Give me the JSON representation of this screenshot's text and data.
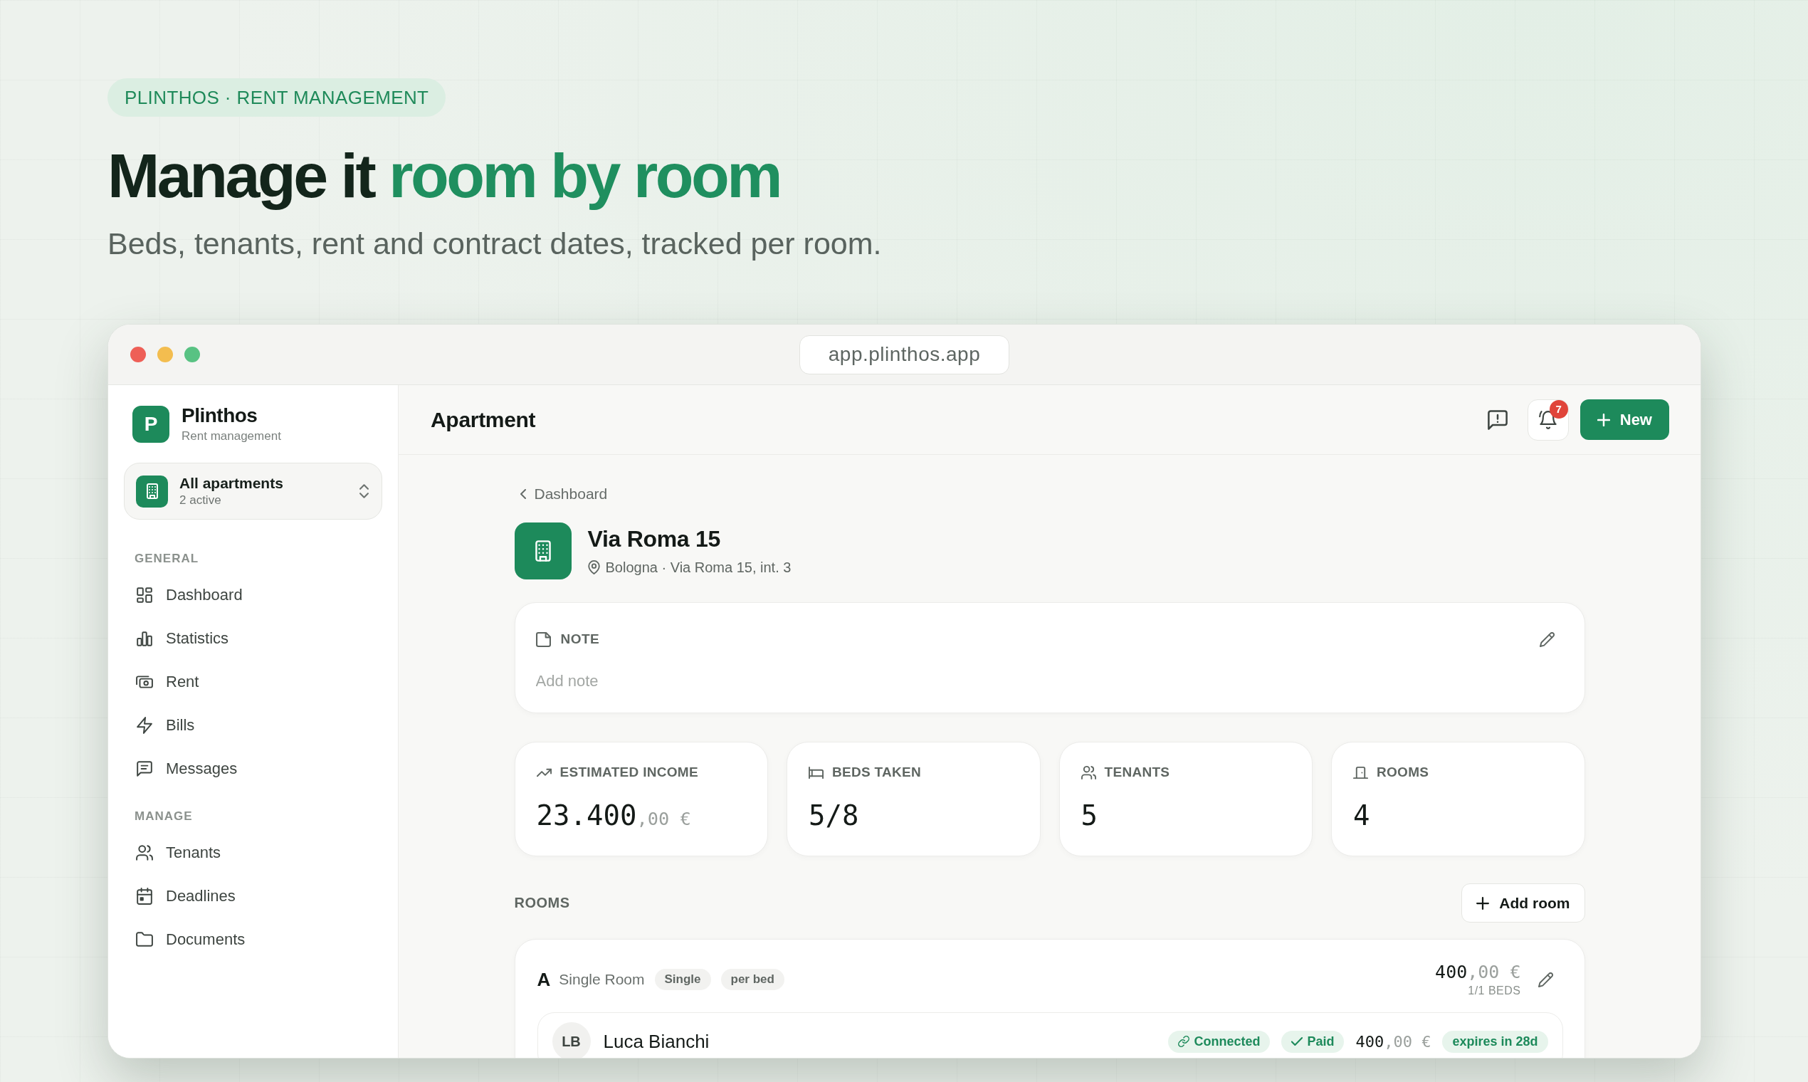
{
  "hero": {
    "eyebrow": "PLINTHOS · RENT MANAGEMENT",
    "title": "Manage it",
    "title_accent": "room by room",
    "subtitle": "Beds, tenants, rent and contract dates, tracked per room."
  },
  "window": {
    "url": "app.plinthos.app"
  },
  "sidebar": {
    "brand": {
      "logo": "P",
      "name": "Plinthos",
      "tagline": "Rent management"
    },
    "switcher": {
      "title": "All apartments",
      "subtitle": "2 active"
    },
    "sections": [
      {
        "heading": "GENERAL",
        "items": [
          {
            "label": "Dashboard",
            "selected": false
          },
          {
            "label": "Statistics",
            "selected": false
          },
          {
            "label": "Rent",
            "selected": false
          },
          {
            "label": "Bills",
            "selected": false
          },
          {
            "label": "Messages",
            "selected": false
          }
        ]
      },
      {
        "heading": "MANAGE",
        "items": [
          {
            "label": "Tenants",
            "selected": false
          },
          {
            "label": "Deadlines",
            "selected": false
          },
          {
            "label": "Documents",
            "selected": false
          }
        ]
      }
    ]
  },
  "header": {
    "title": "Apartment",
    "notification_count": "7",
    "new_button": "New"
  },
  "breadcrumb": {
    "label": "Dashboard"
  },
  "property": {
    "name": "Via Roma 15",
    "location": "Bologna · Via Roma 15, int. 3"
  },
  "note": {
    "label": "NOTE",
    "placeholder": "Add note"
  },
  "stats": [
    {
      "label": "ESTIMATED INCOME",
      "value": "23.400",
      "value_minor": ",00 €"
    },
    {
      "label": "BEDS TAKEN",
      "value": "5/8"
    },
    {
      "label": "TENANTS",
      "value": "5"
    },
    {
      "label": "ROOMS",
      "value": "4"
    }
  ],
  "rooms": {
    "heading": "ROOMS",
    "add_button": "Add room",
    "items": [
      {
        "letter": "A",
        "name": "Single Room",
        "tags": [
          "Single",
          "per bed"
        ],
        "price": "400",
        "price_minor": ",00 €",
        "beds": "1/1 BEDS",
        "tenants": [
          {
            "initials": "LB",
            "name": "Luca Bianchi",
            "connection": "Connected",
            "payment": "Paid",
            "rent": "400",
            "rent_minor": ",00 €",
            "contract": "expires in 28d"
          }
        ]
      }
    ]
  }
}
